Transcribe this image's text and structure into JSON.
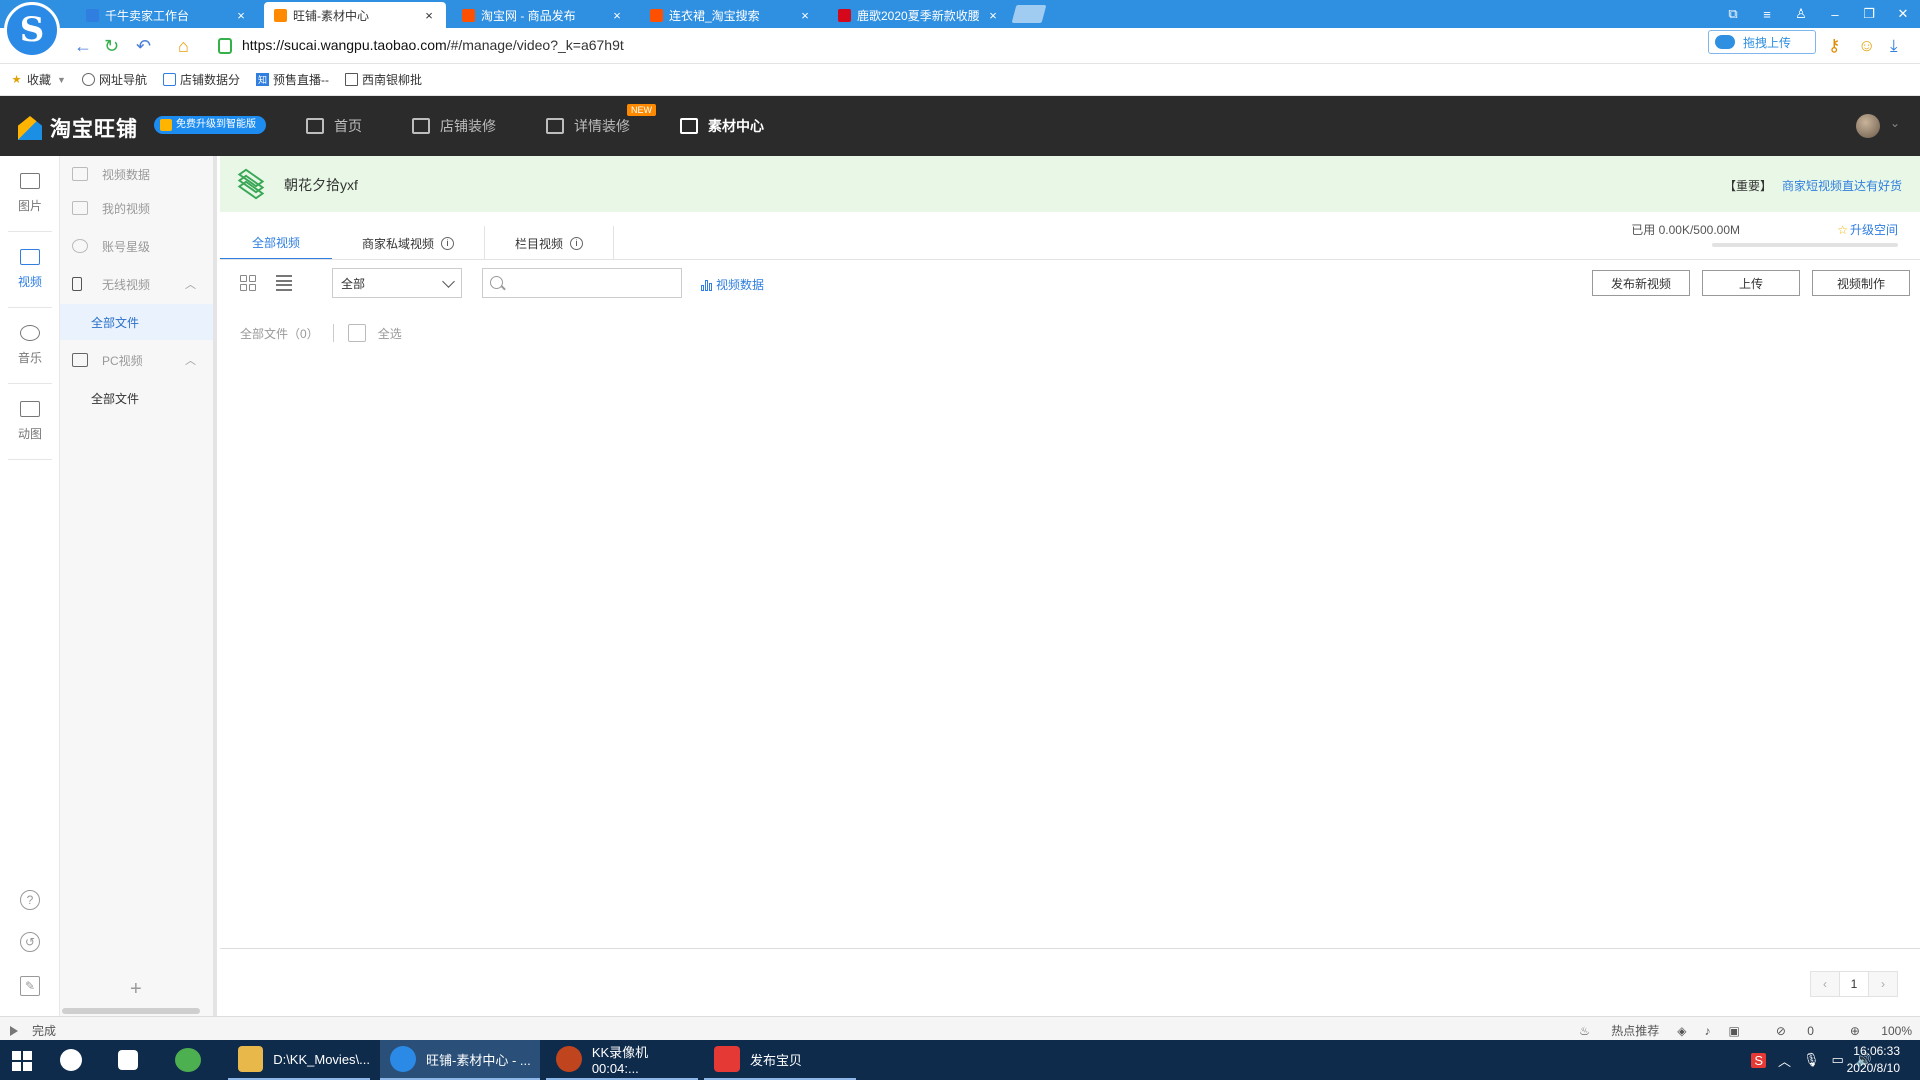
{
  "browser": {
    "logo": "S",
    "tabs": [
      {
        "title": "千牛卖家工作台",
        "icon_color": "#2f7ee0"
      },
      {
        "title": "旺铺-素材中心",
        "icon_color": "#ff8a00"
      },
      {
        "title": "淘宝网 - 商品发布",
        "icon_color": "#ff5000"
      },
      {
        "title": "连衣裙_淘宝搜索",
        "icon_color": "#ff5000"
      },
      {
        "title": "鹿歌2020夏季新款收腰",
        "icon_color": "#d4071b"
      }
    ],
    "close_glyph": "×",
    "url_host": "https://sucai.wangpu.taobao.com",
    "url_path": "/#/manage/video?_k=a67h9t",
    "cloud_upload_label": "拖拽上传",
    "bookmarks": [
      {
        "label": "收藏",
        "icon": "star-icon"
      },
      {
        "label": "网址导航",
        "icon": "globe-icon"
      },
      {
        "label": "店铺数据分",
        "icon": "shop-icon"
      },
      {
        "label": "预售直播--",
        "icon": "zhi-icon"
      },
      {
        "label": "西南银柳批",
        "icon": "doc-icon"
      }
    ]
  },
  "app": {
    "brand": "淘宝旺铺",
    "upgrade_badge": "免费升级到智能版",
    "nav": [
      {
        "label": "首页",
        "icon": "home-icon"
      },
      {
        "label": "店铺装修",
        "icon": "store-icon"
      },
      {
        "label": "详情装修",
        "icon": "detail-icon",
        "badge": "NEW"
      },
      {
        "label": "素材中心",
        "icon": "folder-icon"
      }
    ]
  },
  "rail": [
    {
      "label": "图片",
      "icon": "image-icon"
    },
    {
      "label": "视频",
      "icon": "video-icon"
    },
    {
      "label": "音乐",
      "icon": "music-icon"
    },
    {
      "label": "动图",
      "icon": "gif-icon"
    }
  ],
  "subnav": {
    "items": [
      {
        "label": "视频数据"
      },
      {
        "label": "我的视频"
      },
      {
        "label": "账号星级"
      },
      {
        "label": "无线视频"
      },
      {
        "label": "PC视频"
      }
    ],
    "sub_all_files": "全部文件",
    "add_glyph": "+"
  },
  "notice": {
    "shop_name": "朝花夕拾yxf",
    "tag": "【重要】",
    "link": "商家短视频直达有好货"
  },
  "content_tabs": [
    {
      "label": "全部视频"
    },
    {
      "label": "商家私域视频"
    },
    {
      "label": "栏目视频"
    }
  ],
  "info_glyph": "i",
  "storage": {
    "text": "已用 0.00K/500.00M",
    "used_fraction": 0.0,
    "upgrade_label": "升级空间",
    "star": "☆"
  },
  "toolbar": {
    "select_value": "全部",
    "search_placeholder": "",
    "video_data_link": "视频数据",
    "buttons": [
      "发布新视频",
      "上传",
      "视频制作"
    ]
  },
  "files": {
    "count_label": "全部文件（0）",
    "select_all": "全选"
  },
  "pager": {
    "prev": "‹",
    "current": "1",
    "next": "›"
  },
  "statusbar": {
    "status": "完成",
    "hot": "热点推荐",
    "blocked": "0",
    "zoom": "100%"
  },
  "taskbar": {
    "apps": [
      {
        "label": "D:\\KK_Movies\\...",
        "icon_color": "#e8b84a"
      },
      {
        "label": "旺铺-素材中心 - ...",
        "icon_color": "#2b8ae6"
      },
      {
        "label": "KK录像机 00:04:...",
        "icon_color": "#c0441d"
      },
      {
        "label": "发布宝贝",
        "icon_color": "#e53935"
      }
    ],
    "ime": "S",
    "time": "16:06:33",
    "date": "2020/8/10"
  }
}
